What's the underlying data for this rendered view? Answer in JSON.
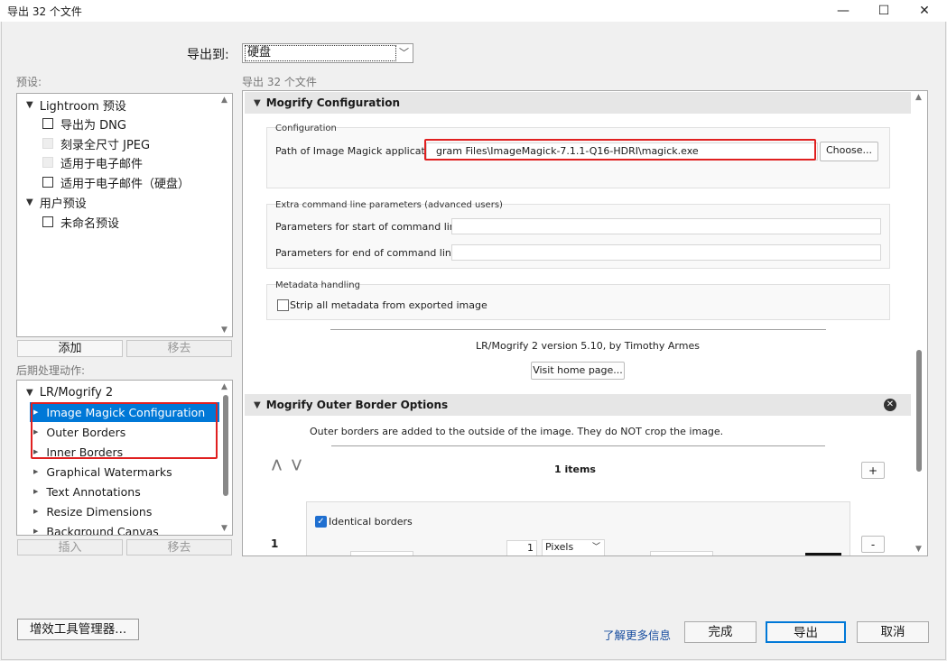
{
  "window": {
    "title": "导出 32 个文件",
    "minimize_glyph": "—",
    "maximize_glyph": "☐",
    "close_glyph": "✕"
  },
  "export_to": {
    "label": "导出到:",
    "value": "硬盘",
    "arrow": "﹀"
  },
  "presets": {
    "label": "预设:",
    "items": [
      {
        "type": "group",
        "label": "Lightroom 预设"
      },
      {
        "type": "item",
        "label": "导出为 DNG",
        "enabled": true
      },
      {
        "type": "item",
        "label": "刻录全尺寸 JPEG",
        "enabled": false
      },
      {
        "type": "item",
        "label": "适用于电子邮件",
        "enabled": false
      },
      {
        "type": "item",
        "label": "适用于电子邮件（硬盘）",
        "enabled": true
      },
      {
        "type": "group",
        "label": "用户预设"
      },
      {
        "type": "item",
        "label": "未命名预设",
        "enabled": true
      }
    ],
    "add_button": "添加",
    "remove_button": "移去"
  },
  "post_process": {
    "label": "后期处理动作:",
    "group_label": "LR/Mogrify 2",
    "items": [
      {
        "label": "Image Magick Configuration",
        "checked": true,
        "selected": true
      },
      {
        "label": "Outer Borders",
        "checked": true,
        "selected": false
      },
      {
        "label": "Inner Borders",
        "checked": false,
        "selected": false
      },
      {
        "label": "Graphical Watermarks",
        "checked": false,
        "selected": false
      },
      {
        "label": "Text Annotations",
        "checked": false,
        "selected": false
      },
      {
        "label": "Resize Dimensions",
        "checked": false,
        "selected": false
      },
      {
        "label": "Background Canvas",
        "checked": false,
        "selected": false
      }
    ],
    "check_glyph": "✔",
    "insert_button": "插入",
    "remove_button": "移去"
  },
  "right": {
    "label": "导出 32 个文件",
    "mogrify_config": {
      "header": "Mogrify Configuration",
      "config_group": "Configuration",
      "path_label": "Path of Image Magick application:",
      "path_value": "gram Files\\ImageMagick-7.1.1-Q16-HDRI\\magick.exe",
      "choose_button": "Choose...",
      "extra_group": "Extra command line parameters (advanced users)",
      "start_label": "Parameters for start of command line:",
      "start_value": "",
      "end_label": "Parameters for end of command line:",
      "end_value": "",
      "metadata_group": "Metadata handling",
      "strip_label": "Strip all metadata from exported image",
      "strip_checked": false,
      "version_text": "LR/Mogrify 2 version 5.10, by Timothy Armes",
      "visit_button": "Visit home page..."
    },
    "outer_border": {
      "header": "Mogrify Outer Border Options",
      "close_glyph": "✕",
      "description": "Outer borders are added to the outside of the image.  They do NOT crop the image.",
      "up_glyph": "⋀",
      "down_glyph": "⋁",
      "items_count": "1 items",
      "add_button": "+",
      "remove_button": "-",
      "row_number": "1",
      "identical_label": "Identical borders",
      "identical_checked": true,
      "size_value": "1",
      "unit_value": "Pixels"
    }
  },
  "footer": {
    "plugin_manager_button": "增效工具管理器...",
    "learn_more_link": "了解更多信息",
    "done_button": "完成",
    "export_button": "导出",
    "cancel_button": "取消"
  },
  "colors": {
    "selection": "#0078d7",
    "annotation_red": "#e02020",
    "checkbox_blue": "#1f6fd0",
    "link": "#1a4fa0"
  }
}
